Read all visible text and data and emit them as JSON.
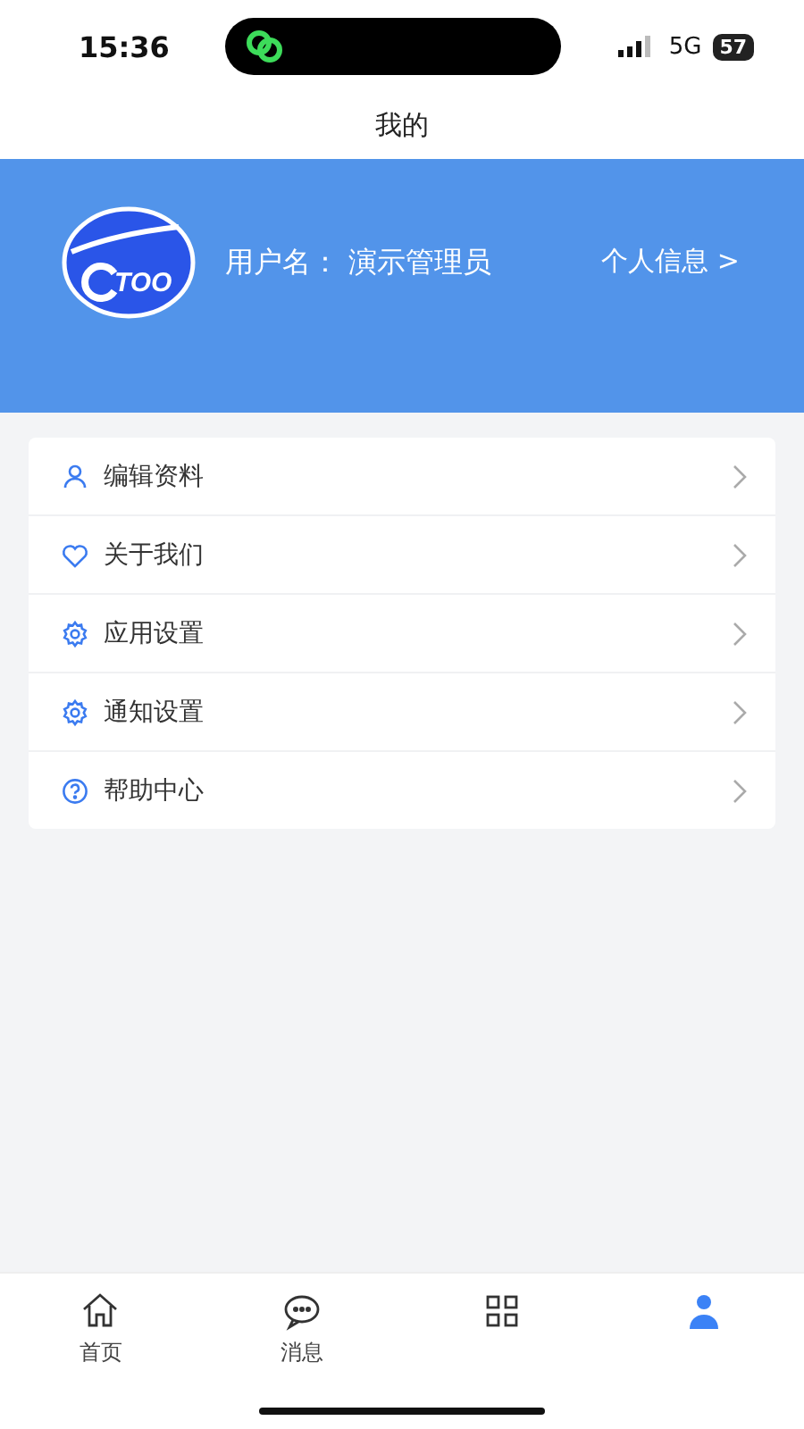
{
  "status_bar": {
    "time": "15:36",
    "network": "5G",
    "battery": "57"
  },
  "header": {
    "title": "我的"
  },
  "profile": {
    "logo_text": "TOO",
    "username_label": "用户名：",
    "username": "演示管理员",
    "link": "个人信息 >"
  },
  "menu": [
    {
      "kind": "user",
      "label": "编辑资料"
    },
    {
      "kind": "heart",
      "label": "关于我们"
    },
    {
      "kind": "gear",
      "label": "应用设置"
    },
    {
      "kind": "gear",
      "label": "通知设置"
    },
    {
      "kind": "help",
      "label": "帮助中心"
    }
  ],
  "tab_bar": [
    {
      "kind": "home",
      "label": "首页",
      "selected": false
    },
    {
      "kind": "chat",
      "label": "消息",
      "selected": false
    },
    {
      "kind": "grid",
      "selected": false
    },
    {
      "kind": "person",
      "selected": true
    }
  ]
}
